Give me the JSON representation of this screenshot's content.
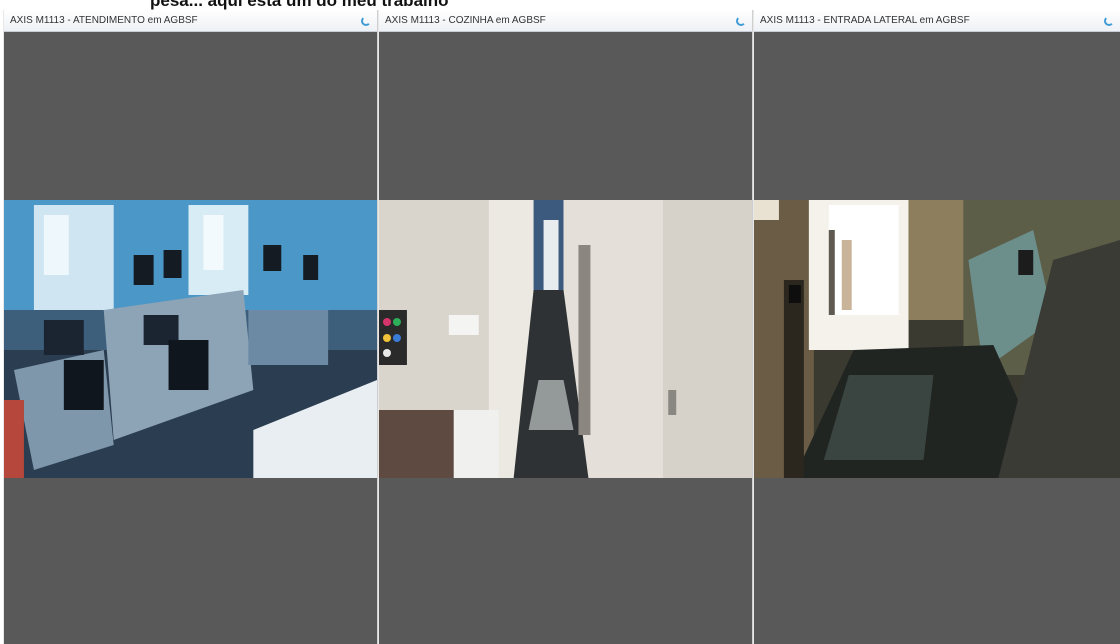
{
  "page": {
    "top_title": "pesa... aqui está um do meu trabalho"
  },
  "panes": [
    {
      "title": "AXIS M1113 - ATENDIMENTO em AGBSF",
      "status_icon": "loading-spinner-icon"
    },
    {
      "title": "AXIS M1113 - COZINHA em AGBSF",
      "status_icon": "loading-spinner-icon"
    },
    {
      "title": "AXIS M1113 - ENTRADA LATERAL em AGBSF",
      "status_icon": "loading-spinner-icon"
    }
  ],
  "colors": {
    "pane_background": "#595959",
    "spinner_accent": "#3f9bd6",
    "header_background": "#eef1f5"
  }
}
